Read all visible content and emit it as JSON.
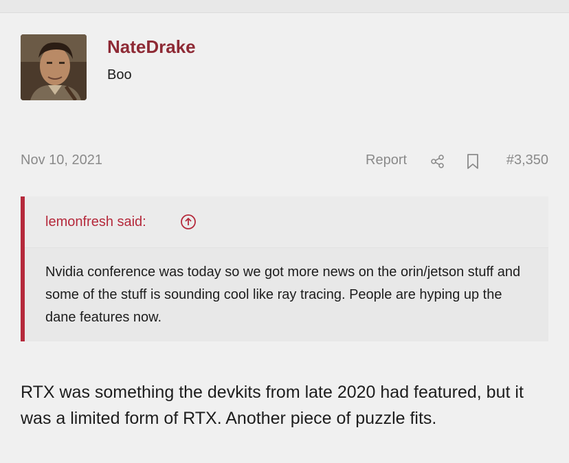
{
  "post": {
    "username": "NateDrake",
    "user_title": "Boo",
    "date": "Nov 10, 2021",
    "report_label": "Report",
    "post_number": "#3,350",
    "quote": {
      "author_label": "lemonfresh said:",
      "body": "Nvidia conference was today so we got more news on the orin/jetson stuff and some of the stuff is sounding cool like ray tracing. People are hyping up the dane features now."
    },
    "message": "RTX was something the devkits from late 2020 had featured, but it was a limited form of RTX. Another piece of puzzle fits."
  },
  "icons": {
    "share": "share-icon",
    "bookmark": "bookmark-icon",
    "quote_jump": "arrow-up-circle-icon"
  },
  "colors": {
    "username": "#8e2a35",
    "quote_accent": "#b5293b",
    "meta_text": "#8a8a8a",
    "background": "#f0f0f0"
  }
}
